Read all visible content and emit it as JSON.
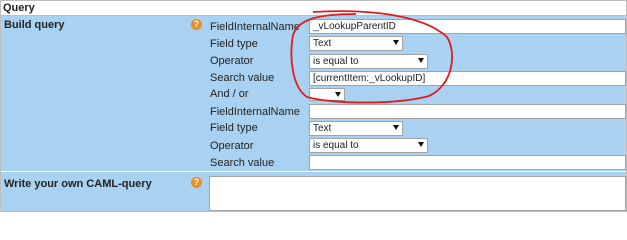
{
  "header": {
    "title": "Query"
  },
  "build": {
    "label": "Build query",
    "help_glyph": "?",
    "rows": [
      {
        "label": "FieldInternalName",
        "value": "_vLookupParentID"
      },
      {
        "label": "Field type",
        "value": "Text"
      },
      {
        "label": "Operator",
        "value": "is equal to"
      },
      {
        "label": "Search value",
        "value": "[currentItem:_vLookupID]"
      },
      {
        "label": "And / or",
        "value": ""
      },
      {
        "label": "FieldInternalName",
        "value": ""
      },
      {
        "label": "Field type",
        "value": "Text"
      },
      {
        "label": "Operator",
        "value": "is equal to"
      },
      {
        "label": "Search value",
        "value": ""
      }
    ]
  },
  "caml": {
    "label": "Write your own CAML-query",
    "help_glyph": "?",
    "value": ""
  },
  "colors": {
    "panel": "#a9d2f2",
    "help": "#f08a1c",
    "annotation": "#e01b1b"
  },
  "icons": {
    "help": "question-circle-icon",
    "dropdown": "chevron-down-icon"
  }
}
